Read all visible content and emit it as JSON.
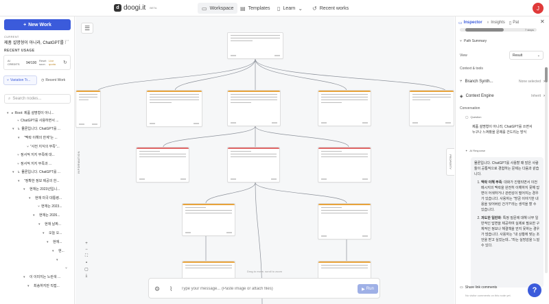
{
  "header": {
    "logo_mark": "d",
    "logo_text": "doogi.it",
    "beta": "BETA",
    "nav": [
      {
        "label": "Workspace",
        "icon": "▭",
        "active": true
      },
      {
        "label": "Templates",
        "icon": "▤"
      },
      {
        "label": "Learn",
        "icon": "▯",
        "chevron": "⌄"
      },
      {
        "label": "Recent works",
        "icon": "↺"
      }
    ],
    "user_initial": "J"
  },
  "sidebar": {
    "new_work": "New Work",
    "current_label": "CURRENT",
    "current_title": "제품 설명형이 아니라, ChatGPT를 쓰...",
    "recent_usage": "RECENT USAGE",
    "ai_credits_label": "AI\nCREDITS",
    "ai_credits_value": "94/100",
    "reset_label": "Reset\nsoon",
    "limit_label": "Live\nquota",
    "tabs": [
      "Variation Tr...",
      "Recent Work"
    ],
    "search_placeholder": "Search nodes...",
    "tree": [
      {
        "label": "Root: 제품 설명형이 아니...",
        "indent": 10,
        "twisty": "▾",
        "icon": "▸"
      },
      {
        "label": "ChatGPT를 사용하면서 ...",
        "indent": 18,
        "twisty": "",
        "icon": "⑂"
      },
      {
        "label": "물론입니다. ChatGPT를 ...",
        "indent": 18,
        "twisty": "▾",
        "icon": "↳"
      },
      {
        "label": "\"맥락 이해의 한계\"는 ...",
        "indent": 26,
        "twisty": "▾",
        "icon": ""
      },
      {
        "label": "\"사전 지식의 부족\"...",
        "indent": 32,
        "twisty": "",
        "icon": "⑂"
      },
      {
        "label": "정서적 지지 부족에 대...",
        "indent": 18,
        "twisty": "",
        "icon": "⑂"
      },
      {
        "label": "정서적 지지 부족과 ...",
        "indent": 18,
        "twisty": "",
        "icon": "⑂"
      },
      {
        "label": "물론입니다. ChatGPT를 ...",
        "indent": 18,
        "twisty": "▾",
        "icon": "↳"
      },
      {
        "label": "\"정확한 정보 제공의 한...",
        "indent": 26,
        "twisty": "▾",
        "icon": ""
      },
      {
        "label": "현재는 2023년입니...",
        "indent": 34,
        "twisty": "▾",
        "icon": ""
      },
      {
        "label": "현재 미국 대통령...",
        "indent": 42,
        "twisty": "▾",
        "icon": ""
      },
      {
        "label": "현재는 2023...",
        "indent": 48,
        "twisty": "",
        "icon": "⑂"
      },
      {
        "label": "현재는 2026...",
        "indent": 48,
        "twisty": "▾",
        "icon": ""
      },
      {
        "label": "현재 날짜...",
        "indent": 56,
        "twisty": "▾",
        "icon": ""
      },
      {
        "label": "오늘 오...",
        "indent": 62,
        "twisty": "▾",
        "icon": ""
      },
      {
        "label": "현재...",
        "indent": 68,
        "twisty": "▾",
        "icon": ""
      },
      {
        "label": "현...",
        "indent": 76,
        "twisty": "▾",
        "icon": ""
      },
      {
        "label": "",
        "indent": 82,
        "twisty": "▾",
        "icon": ""
      },
      {
        "label": "",
        "indent": 88,
        "twisty": "",
        "icon": "⑂"
      },
      {
        "label": "이 이미지는 노란색 ...",
        "indent": 34,
        "twisty": "▾",
        "icon": ""
      },
      {
        "label": "최송하지만 직접...",
        "indent": 40,
        "twisty": "▾",
        "icon": ""
      }
    ]
  },
  "canvas": {
    "side_label": "INFORMATION",
    "note": "Drag to move, scroll to zoom",
    "zoom_controls": [
      "+",
      "−",
      "⛶",
      "▪",
      "▢",
      "⤓"
    ]
  },
  "composer": {
    "placeholder": "Type your message... (Paste image or attach files)",
    "run_label": "Run"
  },
  "property_tab": "PROPERTY",
  "inspector": {
    "tabs": [
      {
        "label": "Inspector",
        "icon": "▭",
        "active": true
      },
      {
        "label": "Insights",
        "icon": "♁"
      },
      {
        "label": "Pat",
        "icon": "▯"
      }
    ],
    "steps": "7 steps",
    "path_summary": "Path Summary",
    "view_label": "View",
    "view_value": "Result",
    "context_title": "Context & tools",
    "branch_label": "Branch Synth...",
    "branch_status": "None selected",
    "context_engine_label": "Context Engine",
    "context_engine_status": "Inherit",
    "conversation_title": "Conversation",
    "question_label": "Question",
    "question_text": "제품 설명형이 아니라, ChatGPT를 쓰면서 누구나 느껴봤을 문제를 건드리는 방식",
    "ai_label": "AI Response",
    "ai_intro": "물론입니다. ChatGPT를 사용할 때 많은 사람들이 공통적으로 경험하는 문제는 다음과 같습니다.",
    "ai_points": [
      {
        "title": "맥락 이해 부족",
        "body": ": 대화가 진행되면서 이전 메시지의 맥락을 완전히 이해하지 못해 답변이 어색하거나 관련성이 떨어지는 경우가 있습니다. 사용자는 \"방금 이야기한 내용을 잊어버린 건가?\"라는 생각을 할 수 있습니다."
      },
      {
        "title": "과도한 일반화",
        "body": ": 특정 질문에 대해 너무 일반적인 답변을 제공하여 실제로 필요한 구체적인 정보나 해결책을 얻지 못하는 경우가 많습니다. 사용자는 \"내 상황에 맞는 조언을 받고 싶었는데...\"라는 실망감을 느낄 수 있다."
      }
    ],
    "share_label": "Share link comments",
    "no_comments": "No visitor comments on this node yet."
  },
  "help_label": "?"
}
